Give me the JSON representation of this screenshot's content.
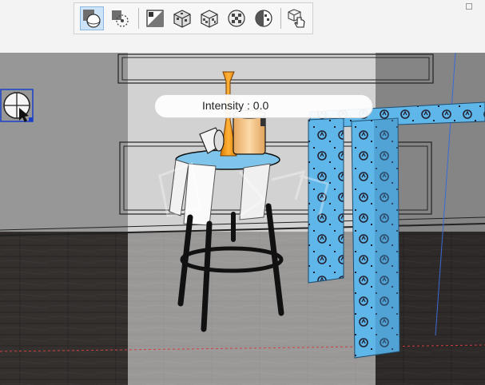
{
  "toolbar": {
    "buttons": [
      {
        "name": "light-sphere-icon",
        "active": true
      },
      {
        "name": "move-light-icon",
        "active": false
      },
      {
        "name": "material-swatch-icon",
        "active": false
      },
      {
        "name": "textured-cube-icon",
        "active": false
      },
      {
        "name": "textured-cube-alt-icon",
        "active": false
      },
      {
        "name": "textured-sphere-icon",
        "active": false
      },
      {
        "name": "split-sphere-icon",
        "active": false
      },
      {
        "name": "hand-cube-icon",
        "active": false
      }
    ]
  },
  "viewport": {
    "intensity_label": "Intensity : 0.0",
    "light_handle_icon": "light-handle-icon",
    "table_pattern_label": "D"
  },
  "colors": {
    "accent": "#1a5fb4",
    "table_blue": "#5ab3e6",
    "floor": "#4a4542",
    "wall": "#e8e8e8",
    "vase": "#f29a1f",
    "jar": "#f5c98a"
  }
}
